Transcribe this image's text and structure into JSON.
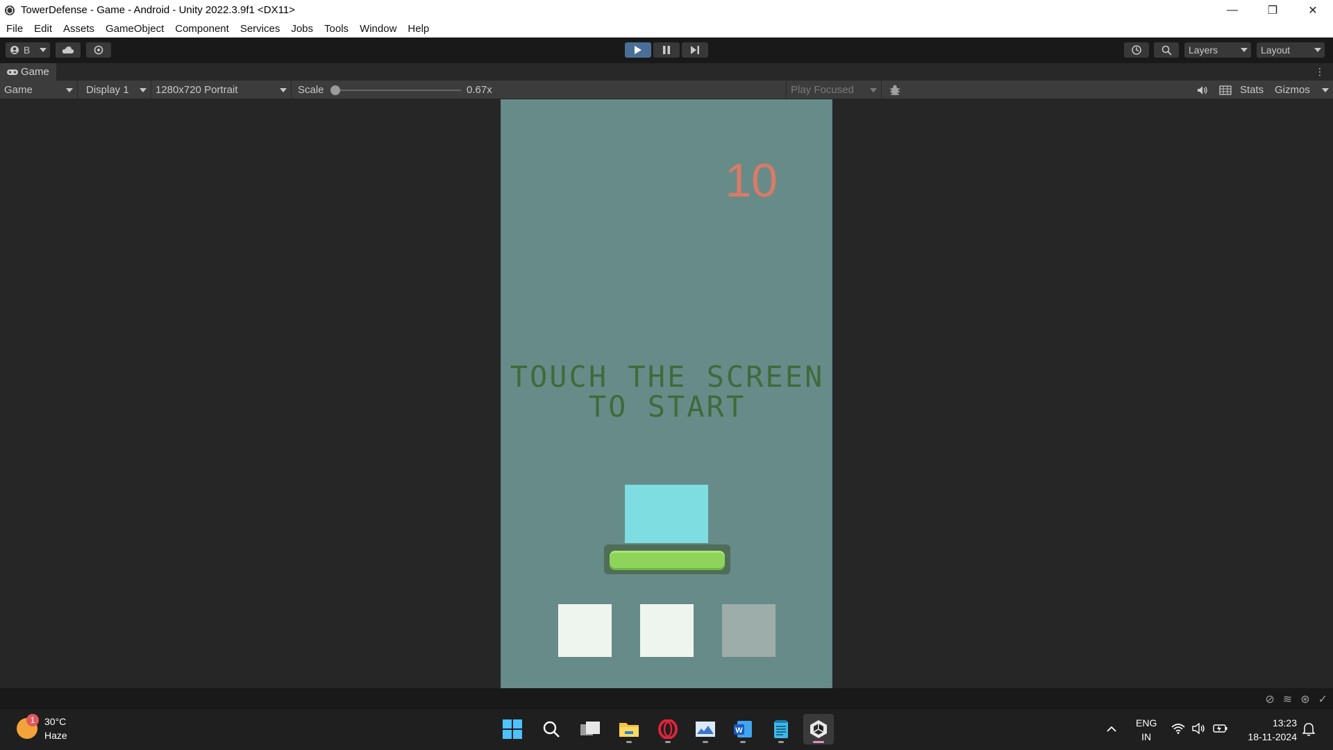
{
  "window": {
    "title": "TowerDefense - Game - Android - Unity 2022.3.9f1 <DX11>",
    "minimize": "—",
    "restore": "❐",
    "close": "✕"
  },
  "menu": [
    "File",
    "Edit",
    "Assets",
    "GameObject",
    "Component",
    "Services",
    "Jobs",
    "Tools",
    "Window",
    "Help"
  ],
  "toolbar": {
    "account_label": "B",
    "layers_label": "Layers",
    "layout_label": "Layout"
  },
  "game_tab": {
    "label": "Game"
  },
  "game_view": {
    "mode": "Game",
    "display": "Display 1",
    "resolution": "1280x720 Portrait",
    "scale_label": "Scale",
    "scale_value": "0.67x",
    "scale_fraction": 0.0,
    "play_mode": "Play Focused",
    "stats_label": "Stats",
    "gizmos_label": "Gizmos"
  },
  "game": {
    "score": "10",
    "prompt_line1": "TOUCH THE SCREEN",
    "prompt_line2": "TO START",
    "health_fraction": 1.0,
    "colors": {
      "background": "#678b89",
      "score": "#d97a66",
      "prompt": "#3f6b3a",
      "tower": "#7ddde1",
      "health": "#8fd45a",
      "slot_active": "#eef5ee",
      "slot_inactive": "#9cadaa"
    },
    "slots": [
      {
        "state": "active"
      },
      {
        "state": "active"
      },
      {
        "state": "inactive"
      }
    ]
  },
  "taskbar": {
    "weather_temp": "30°C",
    "weather_desc": "Haze",
    "weather_badge": "1",
    "lang_line1": "ENG",
    "lang_line2": "IN",
    "time": "13:23",
    "date": "18-11-2024",
    "apps": [
      "start-icon",
      "search-icon",
      "task-view-icon",
      "file-explorer-icon",
      "opera-icon",
      "photos-icon",
      "word-icon",
      "notepad-icon",
      "unity-icon"
    ]
  }
}
